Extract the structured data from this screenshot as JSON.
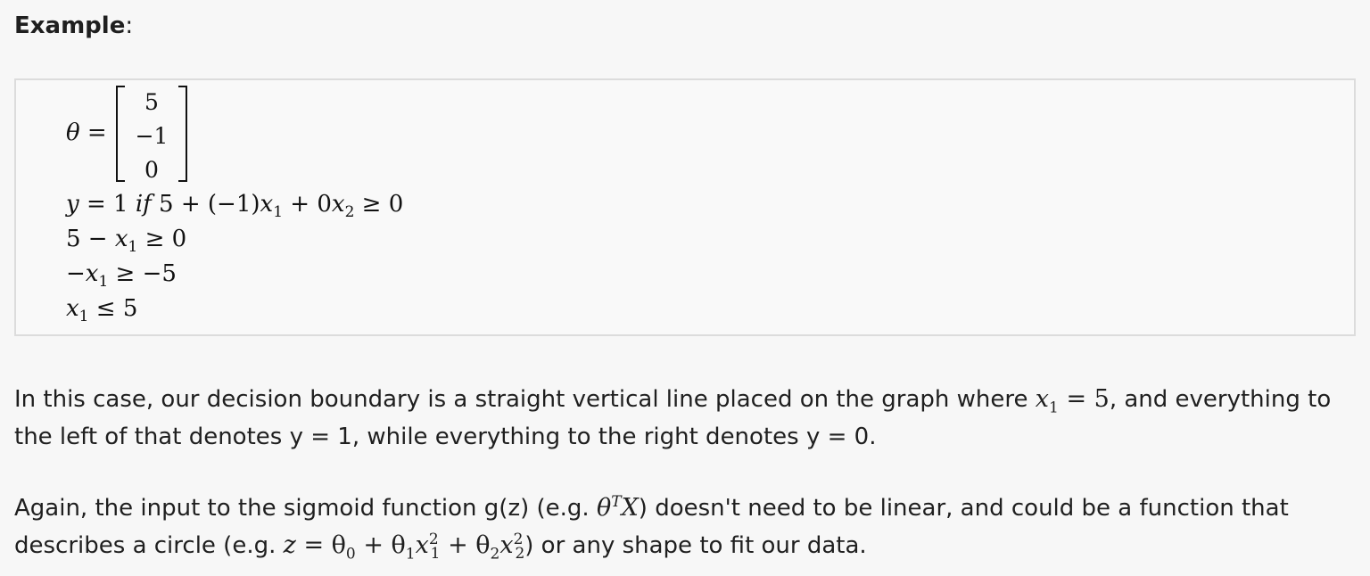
{
  "heading": {
    "bold": "Example",
    "colon": ":"
  },
  "math": {
    "theta_lhs": "θ =",
    "matrix": [
      "5",
      "−1",
      "0"
    ],
    "line1": {
      "y": "y",
      "eq1": " = 1 ",
      "if": "if",
      "rest": " 5 + (−1)",
      "x": "x",
      "sub1": "1",
      "plus": " + 0",
      "x2": "x",
      "sub2": "2",
      "tail": " ≥ 0"
    },
    "line2": {
      "pre": "5 − ",
      "x": "x",
      "sub": "1",
      "tail": " ≥ 0"
    },
    "line3": {
      "pre": "−",
      "x": "x",
      "sub": "1",
      "tail": " ≥ −5"
    },
    "line4": {
      "x": "x",
      "sub": "1",
      "tail": " ≤ 5"
    }
  },
  "para1": {
    "text_a": "In this case, our decision boundary is a straight vertical line placed on the graph where ",
    "math_x": "x",
    "math_sub": "1",
    "math_eq": " = 5",
    "text_b": ", and everything to the left of that denotes y = 1, while everything to the right denotes y = 0."
  },
  "para2": {
    "text_a": "Again, the input to the sigmoid function g(z) (e.g. ",
    "theta": "θ",
    "sup_T": "T",
    "X": "X",
    "text_b": ") doesn't need to be linear, and could be a function that describes a circle (e.g. ",
    "z": "z",
    "eq": " = θ",
    "s0": "0",
    "p1": " + θ",
    "s1": "1",
    "x1": "x",
    "sup1": "2",
    "sub1": "1",
    "p2": " + θ",
    "s2": "2",
    "x2": "x",
    "sup2": "2",
    "sub2": "2",
    "text_c": ") or any shape to fit our data."
  }
}
